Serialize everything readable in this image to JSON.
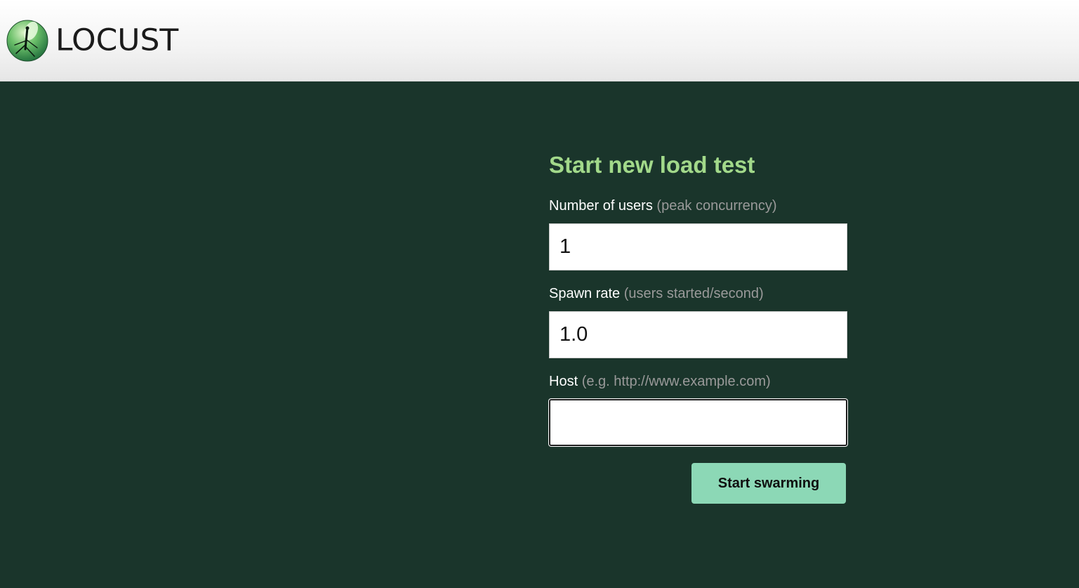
{
  "header": {
    "logo_text": "LOCUST"
  },
  "form": {
    "title": "Start new load test",
    "users": {
      "label": "Number of users",
      "hint": "(peak concurrency)",
      "value": "1"
    },
    "spawn_rate": {
      "label": "Spawn rate",
      "hint": "(users started/second)",
      "value": "1.0"
    },
    "host": {
      "label": "Host",
      "hint": "(e.g. http://www.example.com)",
      "value": ""
    },
    "submit_label": "Start swarming"
  },
  "colors": {
    "background": "#1a352b",
    "title": "#a2d98a",
    "button": "#8cd8b6",
    "hint": "#9a9a9a"
  },
  "icons": {
    "logo": "locust-logo-icon"
  }
}
